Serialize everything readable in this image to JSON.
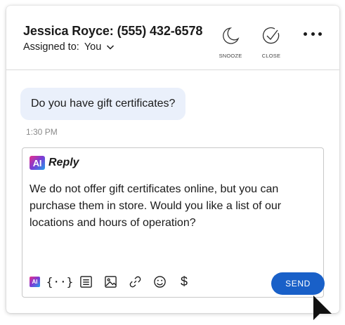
{
  "header": {
    "contact": "Jessica Royce: (555) 432-6578",
    "assigned_label": "Assigned to:",
    "assigned_value": "You",
    "snooze_label": "SNOOZE",
    "close_label": "CLOSE"
  },
  "conversation": {
    "message": "Do you have gift certificates?",
    "time": "1:30 PM"
  },
  "reply": {
    "badge": "AI",
    "label": "Reply",
    "text": "We do not offer gift certificates online, but you can purchase them in store. Would you like a list of our locations and hours of operation?",
    "toolbar_badge": "AI",
    "braces": "{··}",
    "dollar": "$",
    "send_label": "SEND"
  },
  "colors": {
    "accent": "#1960c8",
    "bubble": "#eaf0fb"
  },
  "icons": [
    "chevron-down-icon",
    "moon-icon",
    "check-circle-icon",
    "more-icon",
    "ai-icon",
    "variables-icon",
    "template-icon",
    "image-icon",
    "link-icon",
    "emoji-icon",
    "dollar-icon",
    "cursor-arrow"
  ]
}
